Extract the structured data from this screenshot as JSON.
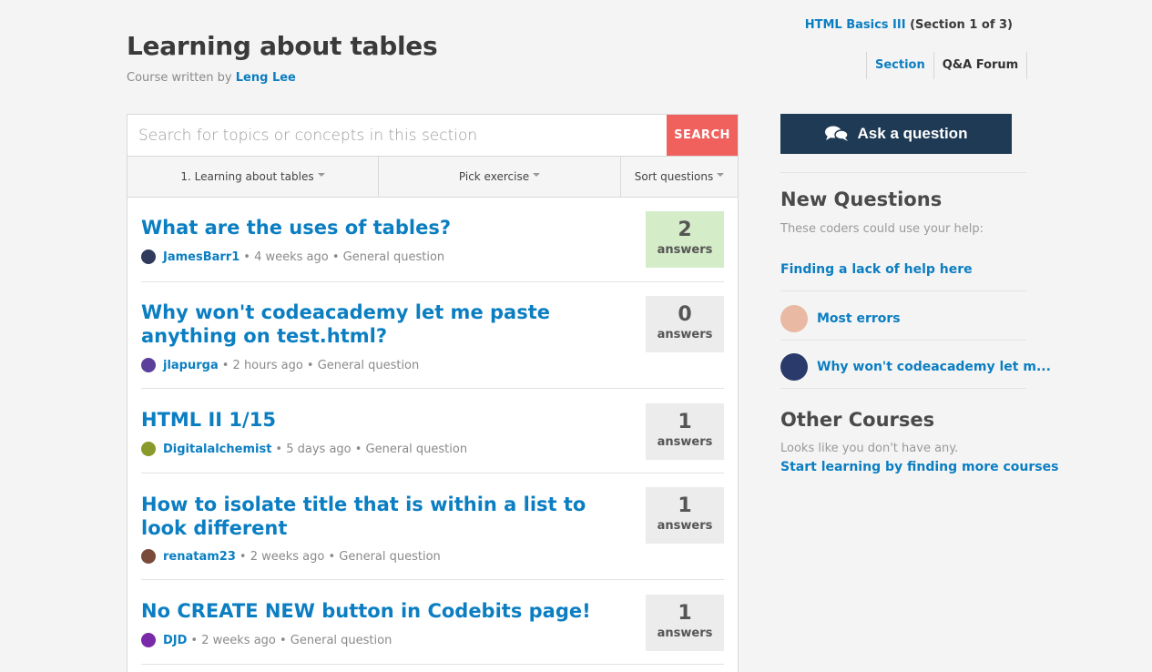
{
  "header": {
    "title": "Learning about tables",
    "byline_prefix": "Course written by",
    "author": "Leng Lee",
    "course_link": "HTML Basics III",
    "course_section": "(Section 1 of 3)",
    "tabs": [
      {
        "label": "Section",
        "active": true
      },
      {
        "label": "Q&A Forum",
        "active": false
      }
    ]
  },
  "search": {
    "placeholder": "Search for topics or concepts in this section",
    "button_label": "SEARCH"
  },
  "filters": {
    "section": "1. Learning about tables",
    "exercise": "Pick exercise",
    "sort": "Sort questions"
  },
  "questions": [
    {
      "title": "What are the uses of tables?",
      "user": "JamesBarr1",
      "meta": "• 4 weeks ago • General question",
      "answers": "2",
      "answers_label": "answers",
      "avatar_color": "#2f3a5c"
    },
    {
      "title": "Why won't codeacademy let me paste anything on test.html?",
      "user": "jlapurga",
      "meta": "• 2 hours ago • General question",
      "answers": "0",
      "answers_label": "answers",
      "avatar_color": "#5b3f9a"
    },
    {
      "title": "HTML II 1/15",
      "user": "Digitalalchemist",
      "meta": "• 5 days ago • General question",
      "answers": "1",
      "answers_label": "answers",
      "avatar_color": "#8a9a2a"
    },
    {
      "title": "How to isolate title that is within a list to look different",
      "user": "renatam23",
      "meta": "• 2 weeks ago • General question",
      "answers": "1",
      "answers_label": "answers",
      "avatar_color": "#7a4a3a"
    },
    {
      "title": "No CREATE NEW button in Codebits page!",
      "user": "DJD",
      "meta": "• 2 weeks ago • General question",
      "answers": "1",
      "answers_label": "answers",
      "avatar_color": "#7a2aa8"
    }
  ],
  "sidebar": {
    "ask_label": "Ask a question",
    "new_questions_heading": "New Questions",
    "new_questions_sub": "These coders could use your help:",
    "new_questions": [
      {
        "label": "Finding a lack of help here",
        "avatar": false,
        "avatar_color": ""
      },
      {
        "label": "Most errors",
        "avatar": true,
        "avatar_color": "#e9b9a4"
      },
      {
        "label": "Why won't codeacademy let m...",
        "avatar": true,
        "avatar_color": "#2a3a6a"
      }
    ],
    "other_courses_heading": "Other Courses",
    "other_courses_sub": "Looks like you don't have any.",
    "other_courses_link": "Start learning by finding more courses"
  },
  "colors": {
    "accent": "#0b7ec2",
    "search_button": "#f0605d",
    "ask_button": "#1e3a55",
    "answered_badge": "#d4ecc8"
  }
}
